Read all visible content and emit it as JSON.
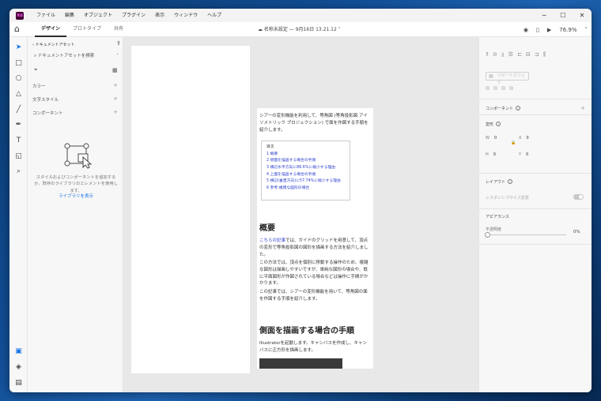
{
  "app": {
    "logo": "Xd"
  },
  "menu": [
    "ファイル",
    "編集",
    "オブジェクト",
    "プラグイン",
    "表示",
    "ウィンドウ",
    "ヘルプ"
  ],
  "window_controls": {
    "minimize": "─",
    "maximize": "☐",
    "close": "✕"
  },
  "toolbar": {
    "tabs": [
      "デザイン",
      "プロトタイプ",
      "共有"
    ],
    "doc_title": "名称未設定 — 9月16日 13.21.12",
    "zoom": "76.9%"
  },
  "assets": {
    "header": "ドキュメントアセット",
    "search_placeholder": "ドキュメントアセットを検索",
    "sections": [
      "カラー",
      "文字スタイル",
      "コンポーネント"
    ],
    "empty_text": "スタイルおよびコンポーネントを追加するか、既存のライブラリのエレメントを使用します。",
    "library_link": "ライブラリを表示"
  },
  "article": {
    "intro": "シアーの変形機能を利用して、等角図 (等角投影図 アイソメトリック プロジェクション) で面を作図する手順を紹介します。",
    "toc_title": "目次",
    "toc_items": [
      "1 概要",
      "2 側面を描画する場合の手順",
      "3 横辺水平方向に86.6%に縮小する理由",
      "4 上面を描画する場合の手順",
      "5 横辺(垂直方向)に57.74%に縮小する理由",
      "6 参考:複雑な図形の場合"
    ],
    "h_overview": "概要",
    "p1_link": "こちらの記事",
    "p1_rest": "では、ガイドのグリッドを用意して、頂点の変形で等角投影図の図形を描画する方法を紹介しました。",
    "p2": "この方法では、頂点を個別に移動する操作のため、複雑な図形は描画しやすいですが、単純な図形の場合や、既に平面図形が作図されている場合などは操作に手間がかかります。",
    "p3": "この記事では、シアーの変形機能を用いて、等角図の面を作図する手順を紹介します。",
    "h_side": "側面を描画する場合の手順",
    "p4": "Illustratorを起動します。キャンバスを作成し、キャンバスに正方形を描画します。"
  },
  "props": {
    "repeat_grid": "リピートグリッド",
    "component": "コンポーネント",
    "transform": "変形",
    "w_label": "W",
    "w_value": "0",
    "x_label": "X",
    "x_value": "0",
    "h_label": "H",
    "h_value": "0",
    "y_label": "Y",
    "y_value": "0",
    "layout": "レイアウト",
    "responsive": "レスポンシブサイズ変更",
    "appearance": "アピアランス",
    "opacity_label": "不透明度",
    "opacity_value": "0%"
  },
  "colors": {
    "accent": "#1473e6",
    "link": "#2b3fcc",
    "xd_bg": "#450135",
    "xd_fg": "#ff61f6"
  }
}
